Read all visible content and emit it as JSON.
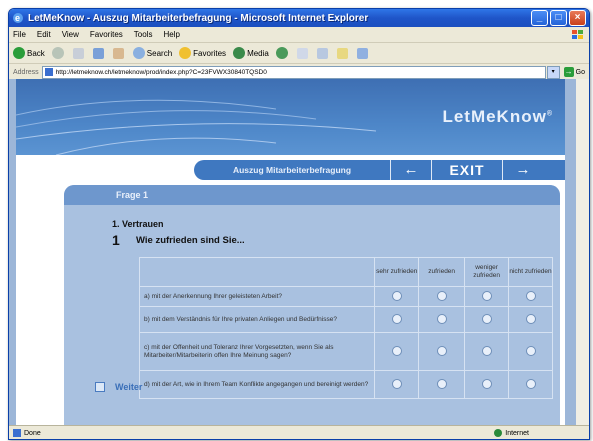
{
  "window": {
    "title": "LetMeKnow - Auszug Mitarbeiterbefragung - Microsoft Internet Explorer"
  },
  "menu": [
    "File",
    "Edit",
    "View",
    "Favorites",
    "Tools",
    "Help"
  ],
  "toolbar": {
    "back": "Back",
    "search": "Search",
    "favorites": "Favorites",
    "media": "Media"
  },
  "address": {
    "label": "Address",
    "url": "http://letmeknow.ch/letmeknow/prod/index.php?C=23FVWX30840TQSD0",
    "go": "Go"
  },
  "site": {
    "brand": "LetMeKnow",
    "brand_mark": "®",
    "nav_title": "Auszug Mitarbeiterbefragung",
    "prev": "←",
    "exit": "EXIT",
    "next": "→"
  },
  "question": {
    "header": "Frage 1",
    "section": "1. Vertrauen",
    "number": "1",
    "text": "Wie zufrieden sind Sie...",
    "columns": [
      "sehr zufrieden",
      "zufrieden",
      "weniger zufrieden",
      "nicht zufrieden"
    ],
    "rows": [
      "a) mit der Anerkennung Ihrer geleisteten Arbeit?",
      "b) mit dem Verständnis für Ihre privaten Anliegen und Bedürfnisse?",
      "c) mit der Offenheit und Toleranz Ihrer Vorgesetzten, wenn Sie als Mitarbeiter/Mitarbeiterin offen Ihre Meinung sagen?",
      "d) mit der Art, wie in Ihrem Team Konflikte angegangen und bereinigt werden?"
    ],
    "next_label": "Weiter"
  },
  "status": {
    "left": "Done",
    "zone": "Internet"
  }
}
